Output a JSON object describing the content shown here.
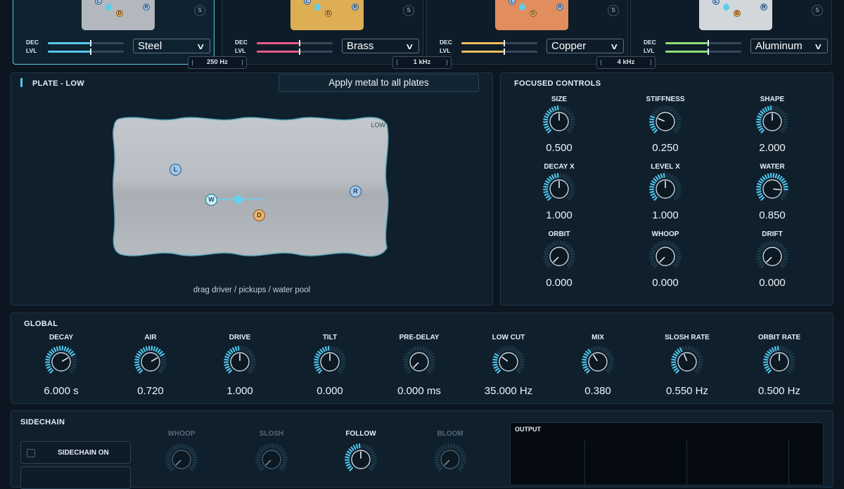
{
  "plates": [
    {
      "metal": "Steel",
      "color": "#b7bcc2",
      "bar": "#58c8ee",
      "selected": true
    },
    {
      "metal": "Brass",
      "color": "#e3b257",
      "bar": "#e85a88",
      "selected": false
    },
    {
      "metal": "Copper",
      "color": "#e69060",
      "bar": "#eebf5a",
      "selected": false
    },
    {
      "metal": "Aluminum",
      "color": "#d6dbe0",
      "bar": "#8fe07a",
      "selected": false
    }
  ],
  "plate_ui": {
    "dec_label": "DEC",
    "lvl_label": "LVL",
    "solo_label": "S",
    "pickup_left": "L",
    "pickup_right": "R",
    "driver": "D",
    "water": "W"
  },
  "crossovers": [
    "250 Hz",
    "1 kHz",
    "4 kHz"
  ],
  "editor": {
    "title": "PLATE - LOW",
    "apply_label": "Apply metal to all plates",
    "plate_tag": "LOW",
    "hint": "drag driver / pickups / water pool"
  },
  "focused": {
    "title": "FOCUSED CONTROLS",
    "knobs": [
      {
        "label": "SIZE",
        "value": "0.500",
        "level": 0.5
      },
      {
        "label": "STIFFNESS",
        "value": "0.250",
        "level": 0.25
      },
      {
        "label": "SHAPE",
        "value": "2.000",
        "level": 0.5
      },
      {
        "label": "DECAY X",
        "value": "1.000",
        "level": 0.5
      },
      {
        "label": "LEVEL X",
        "value": "1.000",
        "level": 0.5
      },
      {
        "label": "WATER",
        "value": "0.850",
        "level": 0.85
      },
      {
        "label": "ORBIT",
        "value": "0.000",
        "level": 0.0
      },
      {
        "label": "WHOOP",
        "value": "0.000",
        "level": 0.0
      },
      {
        "label": "DRIFT",
        "value": "0.000",
        "level": 0.0
      }
    ]
  },
  "global": {
    "title": "GLOBAL",
    "knobs": [
      {
        "label": "DECAY",
        "value": "6.000 s",
        "level": 0.72
      },
      {
        "label": "AIR",
        "value": "0.720",
        "level": 0.72
      },
      {
        "label": "DRIVE",
        "value": "1.000",
        "level": 0.5
      },
      {
        "label": "TILT",
        "value": "0.000",
        "level": 0.5
      },
      {
        "label": "PRE-DELAY",
        "value": "0.000 ms",
        "level": 0.0
      },
      {
        "label": "LOW CUT",
        "value": "35.000 Hz",
        "level": 0.3
      },
      {
        "label": "MIX",
        "value": "0.380",
        "level": 0.38
      },
      {
        "label": "SLOSH RATE",
        "value": "0.550 Hz",
        "level": 0.42
      },
      {
        "label": "ORBIT RATE",
        "value": "0.500 Hz",
        "level": 0.5
      }
    ]
  },
  "sidechain": {
    "title": "SIDECHAIN",
    "on_label": "SIDECHAIN ON",
    "knobs": [
      {
        "label": "WHOOP",
        "level": 0.0
      },
      {
        "label": "SLOSH",
        "level": 0.0
      },
      {
        "label": "FOLLOW",
        "level": 0.5
      },
      {
        "label": "BLOOM",
        "level": 0.0
      }
    ]
  },
  "output": {
    "title": "OUTPUT"
  },
  "colors": {
    "accent": "#4fc6ec",
    "panel": "#0f1f2c",
    "background": "#0b1620"
  }
}
